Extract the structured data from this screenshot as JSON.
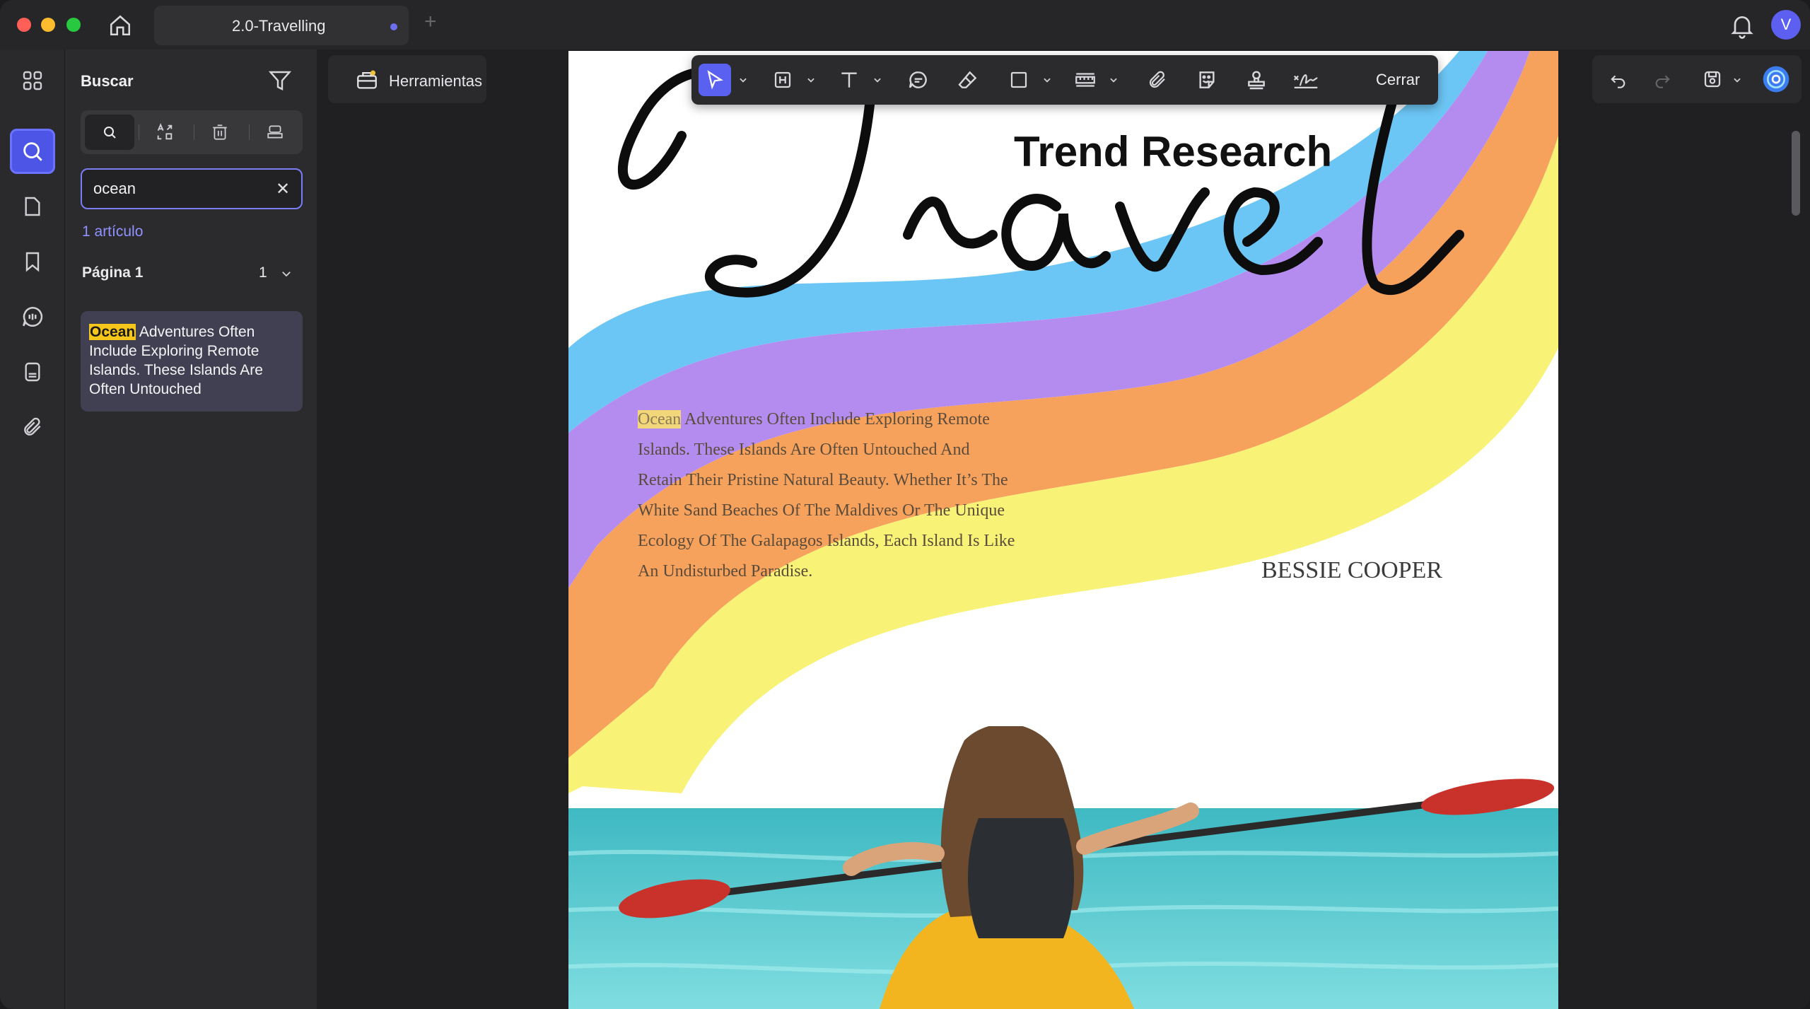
{
  "window": {
    "tab_title": "2.0-Travelling",
    "avatar_letter": "V"
  },
  "search_panel": {
    "title": "Buscar",
    "query": "ocean",
    "result_count": "1 artículo",
    "page_label": "Página 1",
    "page_hits": "1",
    "result": {
      "highlight": "Ocean",
      "rest": " Adventures Often Include Exploring Remote Islands. These Islands Are Often Untouched"
    }
  },
  "toolbar": {
    "tools_label": "Herramientas",
    "close_label": "Cerrar"
  },
  "document": {
    "script_title": "Travel",
    "title": "Trend Research",
    "body_highlight": "Ocean",
    "body_lines": [
      " Adventures Often Include Exploring Remote",
      "Islands. These Islands Are Often Untouched And",
      "Retain Their Pristine Natural Beauty. Whether It’s The",
      "White Sand Beaches Of The Maldives Or The Unique",
      "Ecology Of The Galapagos Islands, Each Island Is Like",
      "An Undisturbed Paradise."
    ],
    "author": "BESSIE COOPER"
  },
  "colors": {
    "accent": "#5a60f0",
    "highlight": "#f6c71a"
  }
}
